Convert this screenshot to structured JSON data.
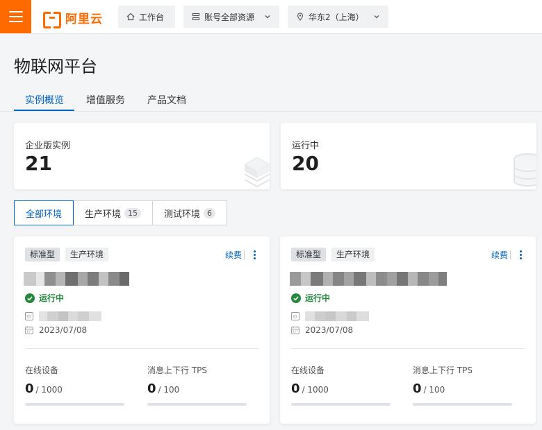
{
  "topbar": {
    "logo_text": "阿里云",
    "workbench_label": "工作台",
    "resources_label": "账号全部资源",
    "region_label": "华东2（上海）",
    "accent_color": "#ff6a00"
  },
  "page": {
    "title": "物联网平台",
    "tabs": [
      {
        "label": "实例概览",
        "active": true
      },
      {
        "label": "增值服务",
        "active": false
      },
      {
        "label": "产品文档",
        "active": false
      }
    ]
  },
  "stats": {
    "enterprise": {
      "label": "企业版实例",
      "value": "21"
    },
    "running": {
      "label": "运行中",
      "value": "20"
    }
  },
  "filters": [
    {
      "label": "全部环境",
      "count": null,
      "active": true
    },
    {
      "label": "生产环境",
      "count": "15",
      "active": false
    },
    {
      "label": "测试环境",
      "count": "6",
      "active": false
    }
  ],
  "instances": [
    {
      "type_tag": "标准型",
      "env_tag": "生产环境",
      "renew_label": "续费",
      "status": "运行中",
      "date": "2023/07/08",
      "devices": {
        "label": "在线设备",
        "value": "0",
        "max": "/ 1000",
        "fraction": 0
      },
      "tps": {
        "label": "消息上下行 TPS",
        "value": "0",
        "max": "/ 100",
        "fraction": 0
      }
    },
    {
      "type_tag": "标准型",
      "env_tag": "生产环境",
      "renew_label": "续费",
      "status": "运行中",
      "date": "2023/07/08",
      "devices": {
        "label": "在线设备",
        "value": "0",
        "max": "/ 1000",
        "fraction": 0
      },
      "tps": {
        "label": "消息上下行 TPS",
        "value": "0",
        "max": "/ 100",
        "fraction": 0
      }
    }
  ],
  "colors": {
    "primary": "#0064c8",
    "success": "#23883c"
  }
}
